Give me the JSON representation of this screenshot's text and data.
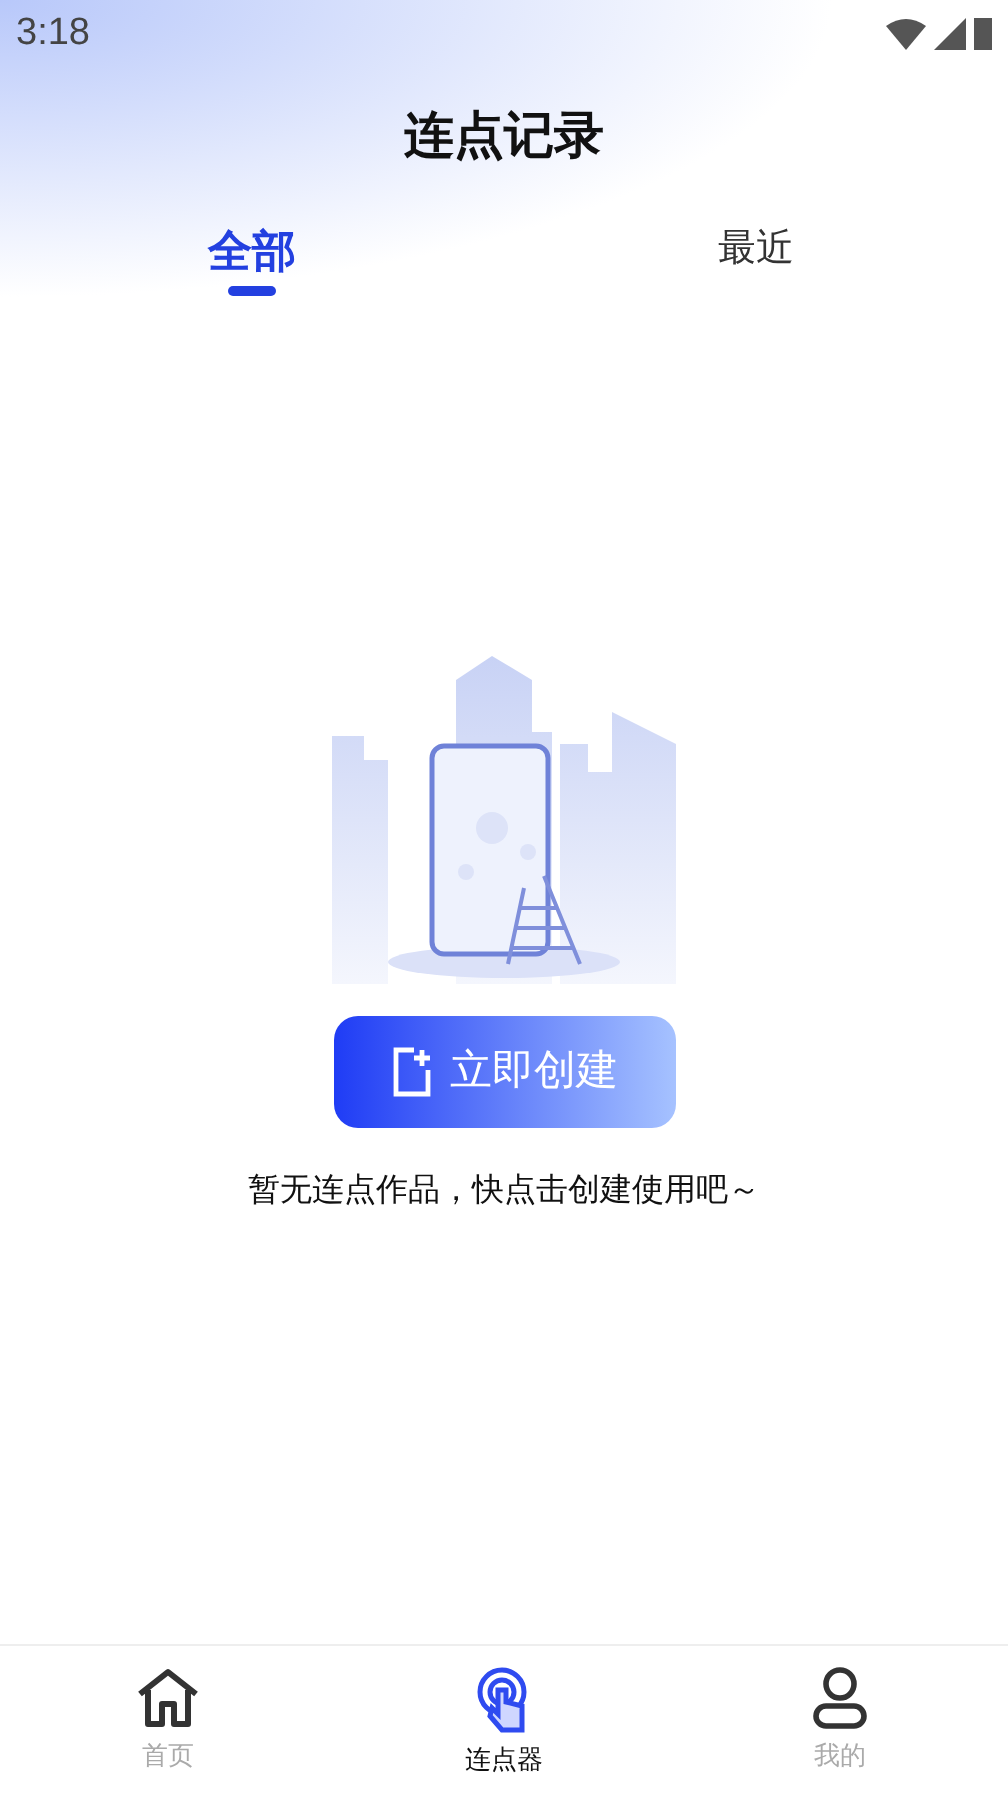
{
  "status_bar": {
    "time": "3:18"
  },
  "title": "连点记录",
  "tabs": [
    {
      "label": "全部",
      "selected": true
    },
    {
      "label": "最近",
      "selected": false
    }
  ],
  "empty_state": {
    "button": "立即创建",
    "message": "暂无连点作品，快点击创建使用吧～"
  },
  "nav": [
    {
      "label": "首页",
      "kind": "home",
      "selected": false
    },
    {
      "label": "连点器",
      "kind": "tap",
      "selected": true
    },
    {
      "label": "我的",
      "kind": "user",
      "selected": false
    }
  ]
}
